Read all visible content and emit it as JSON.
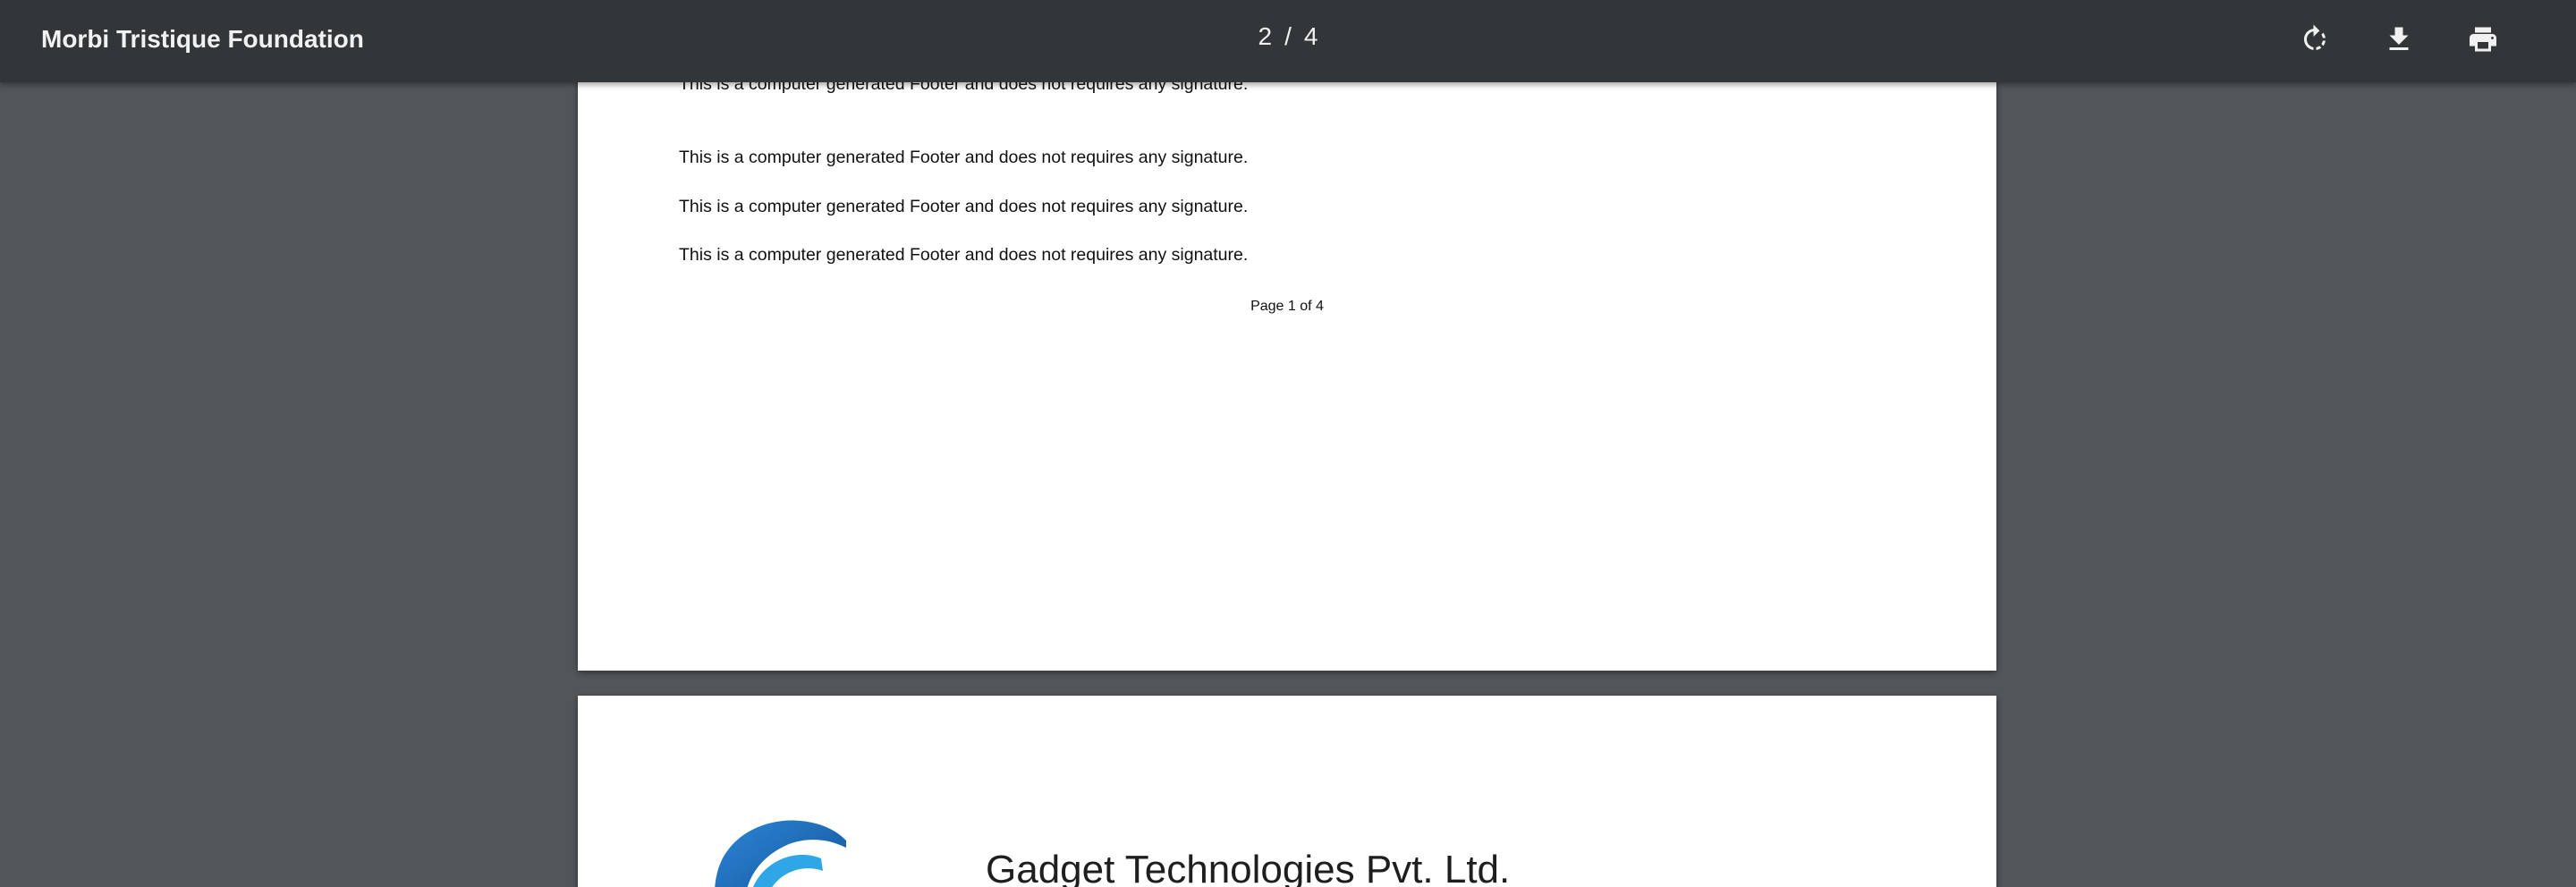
{
  "toolbar": {
    "title": "Morbi Tristique Foundation",
    "current_page": "2",
    "page_separator": "/",
    "total_pages": "4",
    "icons": {
      "rotate": "rotate-icon",
      "download": "download-icon",
      "print": "print-icon"
    }
  },
  "pages": [
    {
      "footer_lines": [
        "This is a computer generated Footer and does not requires any signature.",
        "This is a computer generated Footer and does not requires any signature.",
        "This is a computer generated Footer and does not requires any signature.",
        "This is a computer generated Footer and does not requires any signature."
      ],
      "page_number": "Page 1 of 4"
    },
    {
      "company_name": "Gadget Technologies Pvt. Ltd."
    }
  ],
  "colors": {
    "toolbar_bg": "#323639",
    "viewer_bg": "#525659",
    "page_bg": "#ffffff",
    "logo_blue": "#1f6fc0"
  }
}
